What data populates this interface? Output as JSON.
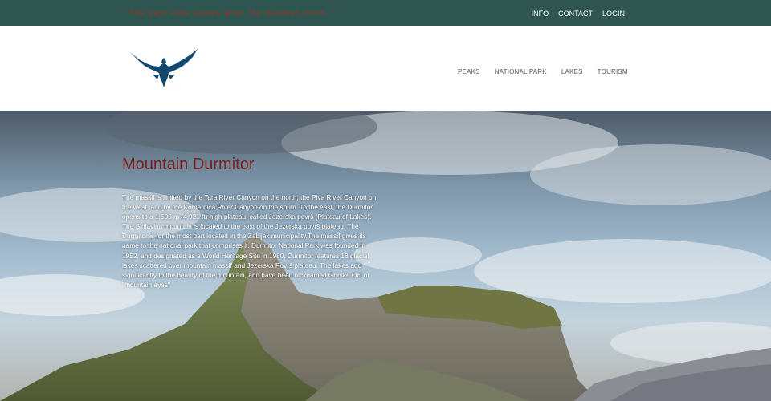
{
  "topbar": {
    "quote": "\" The best view comes after the hardest climb. \"",
    "links": [
      "INFO",
      "CONTACT",
      "LOGIN"
    ]
  },
  "header": {
    "logo_icon": "eagle-icon",
    "nav": [
      "PEAKS",
      "NATIONAL PARK",
      "LAKES",
      "TOURISM"
    ]
  },
  "hero": {
    "title": "Mountain Durmitor",
    "paragraphs": [
      "The massif is limited by the Tara River Canyon on the north, the Piva River Canyon on the west, and by the Komarnica River Canyon on the south. To the east, the Durmitor opens to a 1,500 m (4,921 ft) high plateau, called Jezerska površ (Plateau of Lakes).",
      "The Sinjavina mountain is located to the east of the Jezerska površ plateau. The Durmitor is for the most part located in the Žabljak municipality.The massif gives its name to the national park that comprises it. Durmitor National Park was founded in 1952, and designated as a World Heritage Site in 1980. Durmitor features 18 glacial lakes scattered over mountain massif and Jezerska Površ plateau. The lakes add significantly to the beauty of the mountain, and have been nicknamed Gorske Oči or \"mountain eyes\"."
    ]
  },
  "colors": {
    "topbar_bg": "#2f5550",
    "quote": "#b3261e",
    "title": "#7b1e1e",
    "logo": "#14476e"
  }
}
